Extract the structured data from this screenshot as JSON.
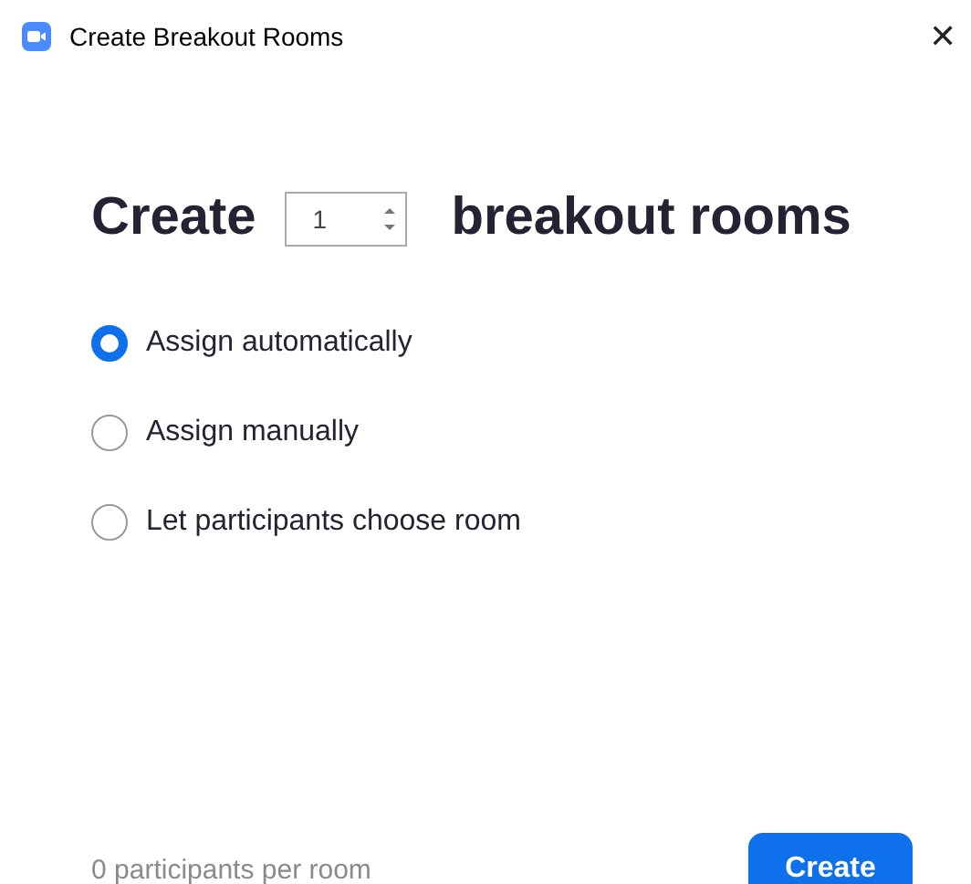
{
  "window": {
    "title": "Create Breakout Rooms",
    "close": "✕"
  },
  "heading": {
    "before": "Create",
    "count": "1",
    "after": "breakout rooms"
  },
  "options": [
    {
      "label": "Assign automatically",
      "selected": true
    },
    {
      "label": "Assign manually",
      "selected": false
    },
    {
      "label": "Let participants choose room",
      "selected": false
    }
  ],
  "footer": {
    "info": "0 participants per room",
    "button": "Create"
  }
}
